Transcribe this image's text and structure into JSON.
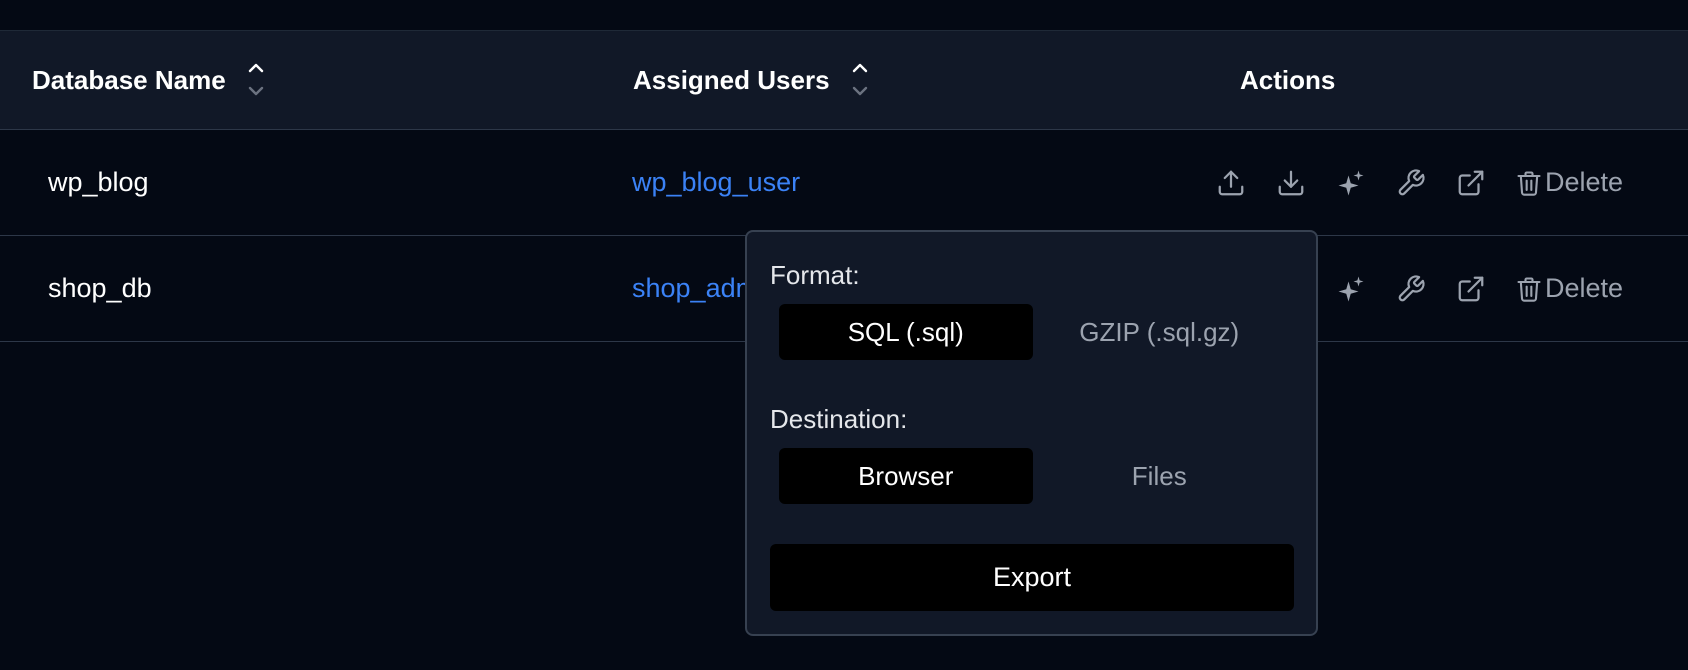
{
  "table": {
    "headers": {
      "name": "Database Name",
      "users": "Assigned Users",
      "actions": "Actions"
    },
    "rows": [
      {
        "name": "wp_blog",
        "user": "wp_blog_user",
        "delete_label": "Delete"
      },
      {
        "name": "shop_db",
        "user": "shop_admin",
        "delete_label": "Delete"
      }
    ],
    "action_icons": [
      "upload-icon",
      "download-icon",
      "sparkles-icon",
      "wrench-icon",
      "external-link-icon",
      "trash-icon"
    ]
  },
  "export_popover": {
    "format_label": "Format:",
    "format_options": [
      "SQL (.sql)",
      "GZIP (.sql.gz)"
    ],
    "format_selected": "SQL (.sql)",
    "destination_label": "Destination:",
    "destination_options": [
      "Browser",
      "Files"
    ],
    "destination_selected": "Browser",
    "export_label": "Export"
  },
  "colors": {
    "background": "#040914",
    "header_bg": "#111827",
    "link": "#3b82f6",
    "muted": "#9ca3af"
  }
}
